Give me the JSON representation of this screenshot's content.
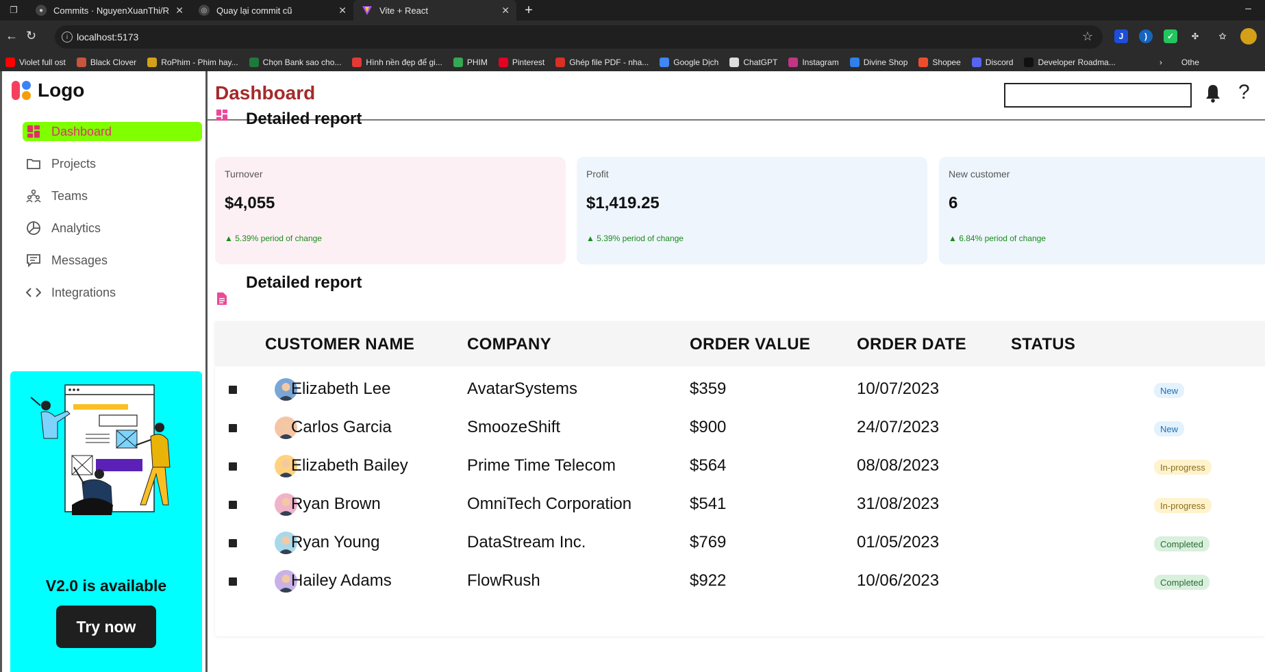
{
  "browser": {
    "tabs": [
      {
        "title": "Commits · NguyenXuanThi/REACT",
        "active": false
      },
      {
        "title": "Quay lại commit cũ",
        "active": false
      },
      {
        "title": "Vite + React",
        "active": true
      }
    ],
    "url": "localhost:5173",
    "bookmarks": [
      {
        "label": "Violet full ost",
        "color": "#ff0000"
      },
      {
        "label": "Black Clover",
        "color": "#c8553d"
      },
      {
        "label": "RoPhim - Phim hay...",
        "color": "#d4a017"
      },
      {
        "label": "Chọn Bank sao cho...",
        "color": "#1f7a3a"
      },
      {
        "label": "Hình nền đẹp để gi...",
        "color": "#e53935"
      },
      {
        "label": "PHIM",
        "color": "#34a853"
      },
      {
        "label": "Pinterest",
        "color": "#e60023"
      },
      {
        "label": "Ghép file PDF - nha...",
        "color": "#d93025"
      },
      {
        "label": "Google Dịch",
        "color": "#4285f4"
      },
      {
        "label": "ChatGPT",
        "color": "#dddddd"
      },
      {
        "label": "Instagram",
        "color": "#c13584"
      },
      {
        "label": "Divine Shop",
        "color": "#2f80ed"
      },
      {
        "label": "Shopee",
        "color": "#ee4d2d"
      },
      {
        "label": "Discord",
        "color": "#5865f2"
      },
      {
        "label": "Developer Roadma...",
        "color": "#111111"
      }
    ],
    "bookmarks_other": "Othe"
  },
  "sidebar": {
    "logo": "Logo",
    "items": [
      {
        "label": "Dashboard",
        "icon": "dashboard-icon",
        "active": true
      },
      {
        "label": "Projects",
        "icon": "folder-icon",
        "active": false
      },
      {
        "label": "Teams",
        "icon": "teams-icon",
        "active": false
      },
      {
        "label": "Analytics",
        "icon": "pie-chart-icon",
        "active": false
      },
      {
        "label": "Messages",
        "icon": "message-icon",
        "active": false
      },
      {
        "label": "Integrations",
        "icon": "code-icon",
        "active": false
      }
    ],
    "promo": {
      "title": "V2.0 is available",
      "button": "Try now"
    }
  },
  "header": {
    "title": "Dashboard"
  },
  "overview": {
    "title": "Detailed report",
    "cards": [
      {
        "label": "Turnover",
        "value": "$4,055",
        "change": "▲ 5.39% period of change",
        "bg": "#fdf0f4"
      },
      {
        "label": "Profit",
        "value": "$1,419.25",
        "change": "▲ 5.39% period of change",
        "bg": "#eef5fd"
      },
      {
        "label": "New customer",
        "value": "6",
        "change": "▲ 6.84% period of change",
        "bg": "#eef5fd"
      }
    ]
  },
  "report": {
    "title": "Detailed report",
    "columns": [
      "CUSTOMER NAME",
      "COMPANY",
      "ORDER VALUE",
      "ORDER DATE",
      "STATUS"
    ],
    "rows": [
      {
        "name": "Elizabeth Lee",
        "company": "AvatarSystems",
        "value": "$359",
        "date": "10/07/2023",
        "status": "New"
      },
      {
        "name": "Carlos Garcia",
        "company": "SmoozeShift",
        "value": "$900",
        "date": "24/07/2023",
        "status": "New"
      },
      {
        "name": "Elizabeth Bailey",
        "company": "Prime Time Telecom",
        "value": "$564",
        "date": "08/08/2023",
        "status": "In-progress"
      },
      {
        "name": "Ryan Brown",
        "company": "OmniTech Corporation",
        "value": "$541",
        "date": "31/08/2023",
        "status": "In-progress"
      },
      {
        "name": "Ryan Young",
        "company": "DataStream Inc.",
        "value": "$769",
        "date": "01/05/2023",
        "status": "Completed"
      },
      {
        "name": "Hailey Adams",
        "company": "FlowRush",
        "value": "$922",
        "date": "10/06/2023",
        "status": "Completed"
      }
    ],
    "status_colors": {
      "New": {
        "bg": "#e3f2fd",
        "fg": "#1e6fb8"
      },
      "In-progress": {
        "bg": "#fff3cd",
        "fg": "#8a6d1a"
      },
      "Completed": {
        "bg": "#d8f0dc",
        "fg": "#2b6a35"
      }
    }
  }
}
